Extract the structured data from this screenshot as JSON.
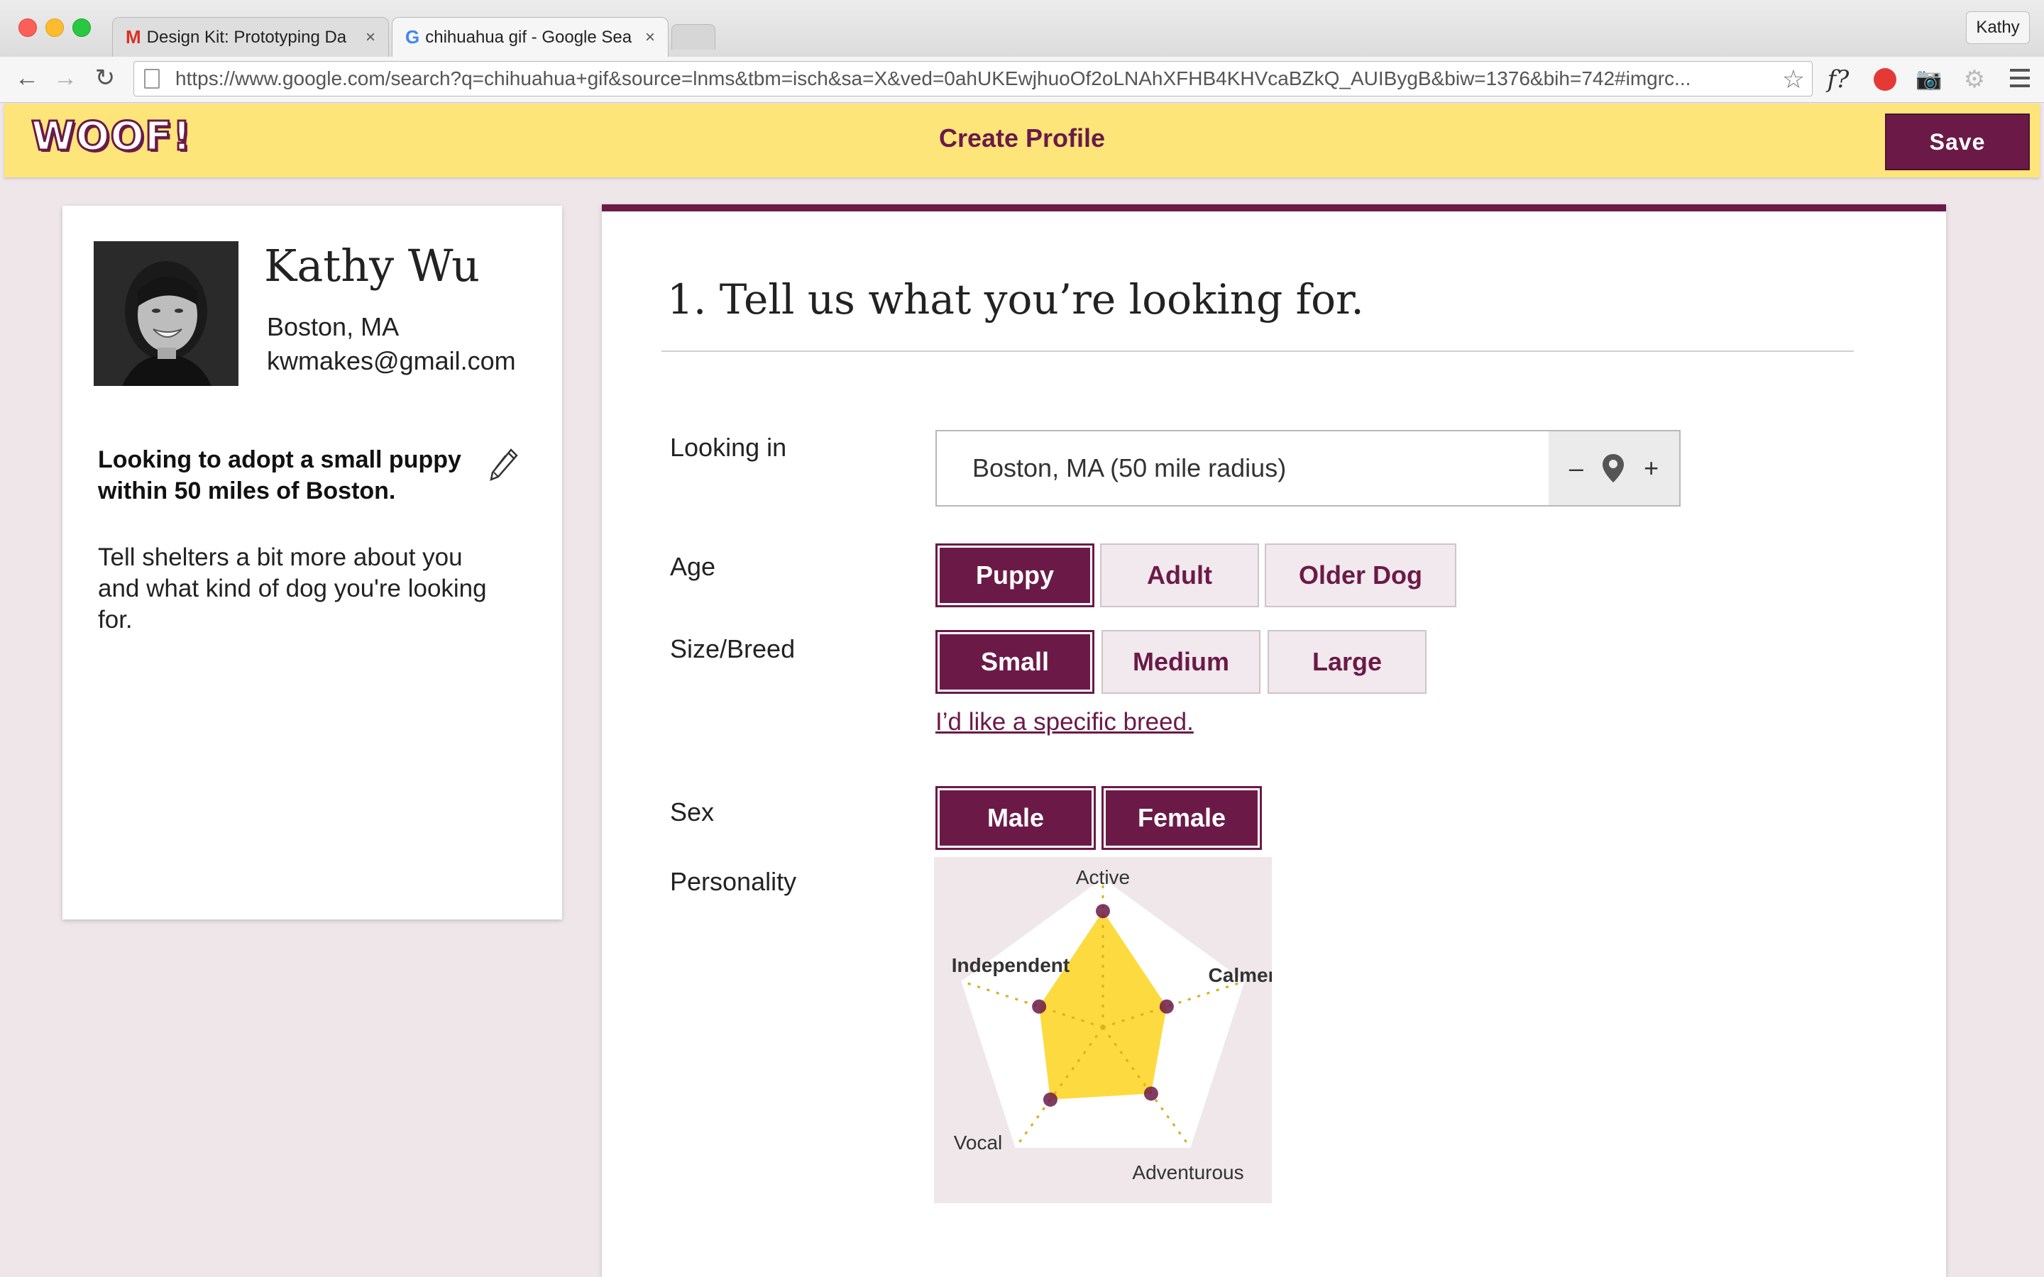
{
  "browser": {
    "tabs": [
      {
        "favicon": "gmail-icon",
        "label": "Design Kit: Prototyping Da",
        "close": "×"
      },
      {
        "favicon": "google-icon",
        "label": "chihuahua gif - Google Sea",
        "close": "×"
      }
    ],
    "profile_name": "Kathy",
    "url": "https://www.google.com/search?q=chihuahua+gif&source=lnms&tbm=isch&sa=X&ved=0ahUKEwjhuoOf2oLNAhXFHB4KHVcaBZkQ_AUIBygB&biw=1376&bih=742#imgrc...",
    "extension_f": "f?"
  },
  "header": {
    "logo": "WOOF!",
    "title": "Create Profile",
    "save_label": "Save"
  },
  "profile": {
    "name": "Kathy Wu",
    "location": "Boston, MA",
    "email": "kwmakes@gmail.com",
    "summary": "Looking to adopt a small puppy within 50 miles of Boston.",
    "blurb": "Tell shelters a bit more about you and what kind of dog you're looking for."
  },
  "form": {
    "heading": "1. Tell us what you’re looking for.",
    "looking_in": {
      "label": "Looking in",
      "value": "Boston, MA (50 mile radius)",
      "minus": "–",
      "plus": "+"
    },
    "age": {
      "label": "Age",
      "options": [
        {
          "label": "Puppy",
          "selected": true
        },
        {
          "label": "Adult",
          "selected": false
        },
        {
          "label": "Older Dog",
          "selected": false
        }
      ]
    },
    "size": {
      "label": "Size/Breed",
      "options": [
        {
          "label": "Small",
          "selected": true
        },
        {
          "label": "Medium",
          "selected": false
        },
        {
          "label": "Large",
          "selected": false
        }
      ],
      "breed_link": "I’d like a specific breed."
    },
    "sex": {
      "label": "Sex",
      "options": [
        {
          "label": "Male",
          "selected": true
        },
        {
          "label": "Female",
          "selected": true
        }
      ]
    },
    "personality": {
      "label": "Personality",
      "axes": [
        {
          "name": "Active",
          "level": 0.78
        },
        {
          "name": "Calmer",
          "level": 0.45
        },
        {
          "name": "Adventurous",
          "level": 0.55
        },
        {
          "name": "Vocal",
          "level": 0.6
        },
        {
          "name": "Independent",
          "level": 0.45
        }
      ]
    }
  },
  "colors": {
    "accent": "#6b1a48",
    "header_bg": "#fde57a",
    "radar_fill": "#fdd835"
  }
}
